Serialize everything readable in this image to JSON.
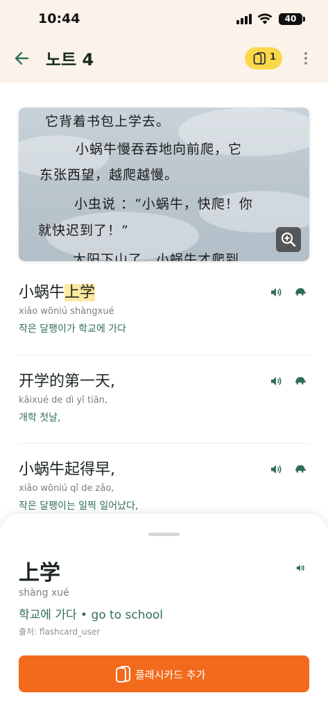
{
  "status": {
    "time": "10:44",
    "battery": "40"
  },
  "header": {
    "title": "노트 4",
    "flashcard_count": "1"
  },
  "photo": {
    "lines": [
      "它背着书包上学去。",
      "小蜗牛慢吞吞地向前爬，它",
      "东张西望，越爬越慢。",
      "小虫说 ：“小蜗牛，快爬！你",
      "就快迟到了！”",
      "太阳下山了，小蜗牛才爬到"
    ]
  },
  "sentences": [
    {
      "zh_before": "小蜗牛",
      "zh_highlight": "上学",
      "zh_after": "",
      "pinyin": "xiǎo wōniú shàngxué",
      "translation": "작은 달팽이가 학교에 가다"
    },
    {
      "zh_before": "开学的第一天,",
      "zh_highlight": "",
      "zh_after": "",
      "pinyin": "kāixué de dì yī tiān,",
      "translation": "개학 첫날,"
    },
    {
      "zh_before": "小蜗牛起得早,",
      "zh_highlight": "",
      "zh_after": "",
      "pinyin": "xiǎo wōniú qǐ de zǎo,",
      "translation": "작은 달팽이는 일찍 일어났다,"
    }
  ],
  "detail": {
    "word": "上学",
    "pinyin": "shàng xué",
    "meaning": "학교에 가다 • go to school",
    "source": "출처: flashcard_user",
    "add_button": "플래시카드 추가"
  },
  "colors": {
    "accent_green": "#2f6e5b",
    "badge_yellow": "#fbd84b",
    "button_orange": "#f26a1b",
    "highlight": "#fde8a0"
  },
  "icons": [
    "arrow-left-icon",
    "flashcard-icon",
    "more-vertical-icon",
    "zoom-in-icon",
    "speaker-icon",
    "turtle-icon"
  ]
}
